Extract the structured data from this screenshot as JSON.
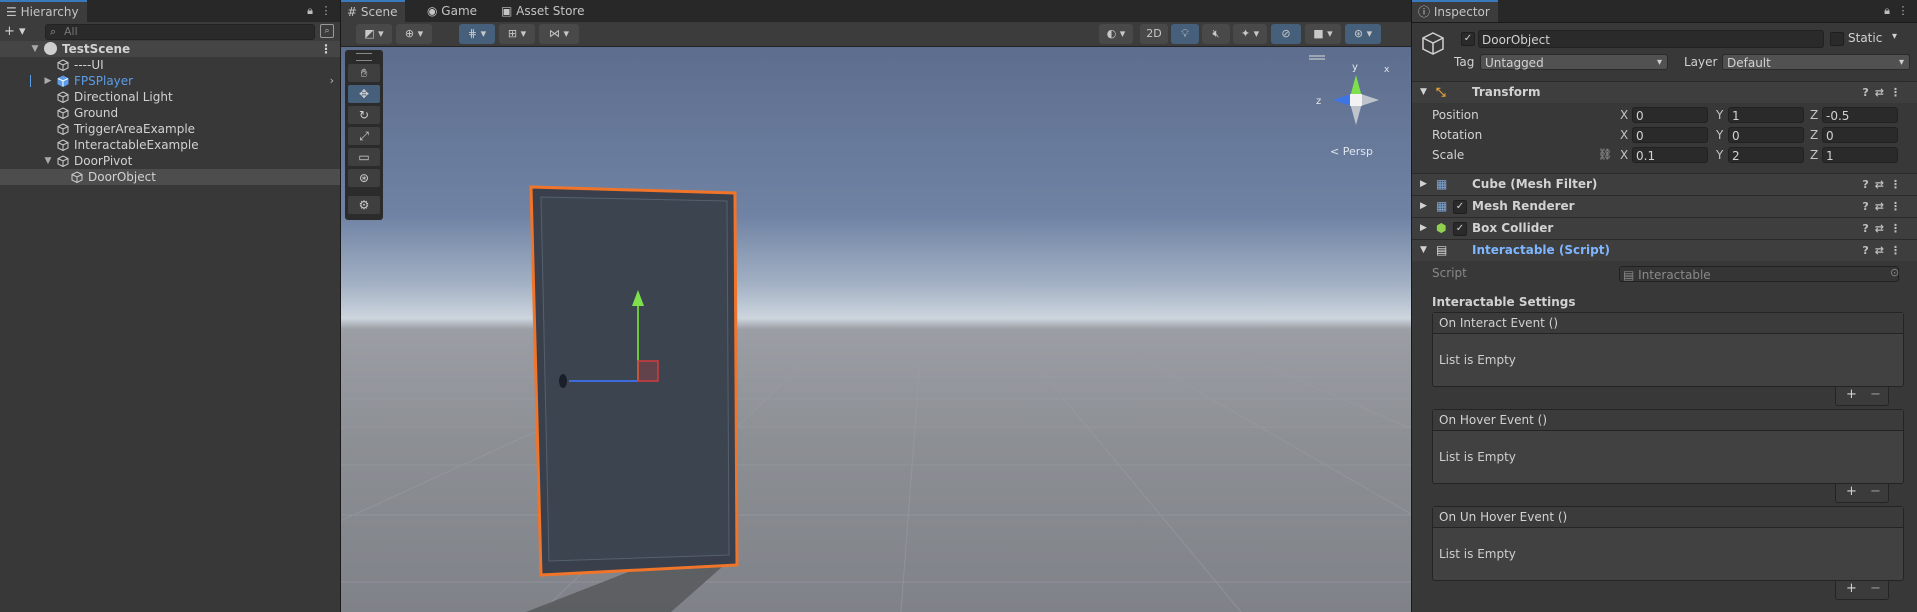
{
  "hierarchy": {
    "tab_label": "Hierarchy",
    "add_label": "+ ▾",
    "search_placeholder": "All",
    "scene_name": "TestScene",
    "items": [
      {
        "label": "----UI",
        "indent": 1,
        "color": "#d2d2d2",
        "arrow": ""
      },
      {
        "label": "FPSPlayer",
        "indent": 1,
        "color": "#5c9ce6",
        "arrow": "▶"
      },
      {
        "label": "Directional Light",
        "indent": 1,
        "color": "#d2d2d2",
        "arrow": ""
      },
      {
        "label": "Ground",
        "indent": 1,
        "color": "#d2d2d2",
        "arrow": ""
      },
      {
        "label": "TriggerAreaExample",
        "indent": 1,
        "color": "#d2d2d2",
        "arrow": ""
      },
      {
        "label": "InteractableExample",
        "indent": 1,
        "color": "#d2d2d2",
        "arrow": ""
      },
      {
        "label": "DoorPivot",
        "indent": 1,
        "color": "#d2d2d2",
        "arrow": "▼"
      },
      {
        "label": "DoorObject",
        "indent": 2,
        "color": "#d2d2d2",
        "arrow": ""
      }
    ]
  },
  "scene_tabs": [
    {
      "label": "Scene",
      "active": true
    },
    {
      "label": "Game",
      "active": false
    },
    {
      "label": "Asset Store",
      "active": false
    }
  ],
  "scene_toolbar": {
    "mode_2d": "2D",
    "persp_label": "< Persp",
    "gizmo_axes": {
      "y": "y",
      "x": "x",
      "z": "z"
    }
  },
  "inspector": {
    "tab_label": "Inspector",
    "object_name": "DoorObject",
    "static_label": "Static",
    "tag_label": "Tag",
    "tag_value": "Untagged",
    "layer_label": "Layer",
    "layer_value": "Default",
    "transform": {
      "title": "Transform",
      "position_label": "Position",
      "rotation_label": "Rotation",
      "scale_label": "Scale",
      "position": {
        "x": "0",
        "y": "1",
        "z": "-0.5"
      },
      "rotation": {
        "x": "0",
        "y": "0",
        "z": "0"
      },
      "scale": {
        "x": "0.1",
        "y": "2",
        "z": "1"
      }
    },
    "components": {
      "mesh_filter": "Cube (Mesh Filter)",
      "mesh_renderer": "Mesh Renderer",
      "box_collider": "Box Collider",
      "interactable": "Interactable (Script)"
    },
    "script_label": "Script",
    "script_value": "Interactable",
    "settings_header": "Interactable Settings",
    "events": [
      {
        "title": "On Interact Event ()",
        "body": "List is Empty"
      },
      {
        "title": "On Hover Event ()",
        "body": "List is Empty"
      },
      {
        "title": "On Un Hover Event ()",
        "body": "List is Empty"
      }
    ],
    "plus_minus": "+   −",
    "axis_labels": {
      "x": "X",
      "y": "Y",
      "z": "Z"
    }
  }
}
